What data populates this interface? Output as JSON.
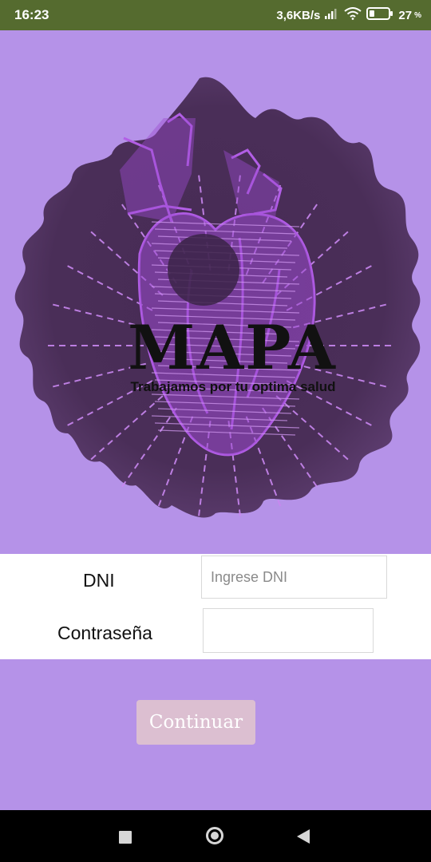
{
  "status_bar": {
    "time": "16:23",
    "network_speed": "3,6KB/s",
    "battery_percent": "27",
    "battery_unit": "%",
    "battery_level": 0.27,
    "icons": [
      "signal-icon",
      "wifi-icon",
      "battery-icon"
    ]
  },
  "hero": {
    "logo_title": "MAPA",
    "logo_tagline": "Trabajamos por tu optima salud",
    "illustration": "anatomical-heart-illustration",
    "colors": {
      "background": "#b592e8",
      "splash": "#4a2e58",
      "heart": "#b25ee6"
    }
  },
  "form": {
    "dni_label": "DNI",
    "dni_placeholder": "Ingrese DNI",
    "dni_value": "",
    "password_label": "Contraseña",
    "password_value": ""
  },
  "actions": {
    "continue_label": "Continuar"
  },
  "nav_bar": {
    "buttons": [
      "recents-icon",
      "home-icon",
      "back-icon"
    ]
  },
  "colors": {
    "status_bar": "#556b2f",
    "page_background": "#b592e8",
    "form_background": "#ffffff",
    "button_background": "#dcbfd1",
    "button_text": "#ffffff"
  }
}
